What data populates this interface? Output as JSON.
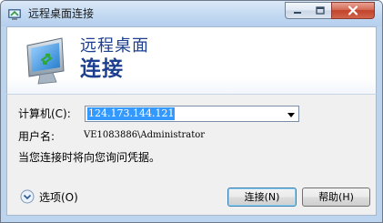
{
  "window": {
    "title": "远程桌面连接",
    "controls": {
      "minimize": "minimize",
      "maximize": "maximize",
      "close": "close"
    }
  },
  "banner": {
    "line1": "远程桌面",
    "line2": "连接",
    "icon": "remote-desktop-monitor-icon"
  },
  "form": {
    "computer_label": "计算机(C):",
    "computer_value": "124.173.144.121",
    "username_label": "用户名:",
    "username_value": "VE1083886\\Administrator",
    "info_text": "当您连接时将向您询问凭据。"
  },
  "footer": {
    "options_label": "选项(O)",
    "connect_label": "连接(N)",
    "help_label": "帮助(H)"
  },
  "colors": {
    "accent": "#1c3f8f",
    "selection": "#3399ff",
    "frame": "#bcd4ee"
  }
}
